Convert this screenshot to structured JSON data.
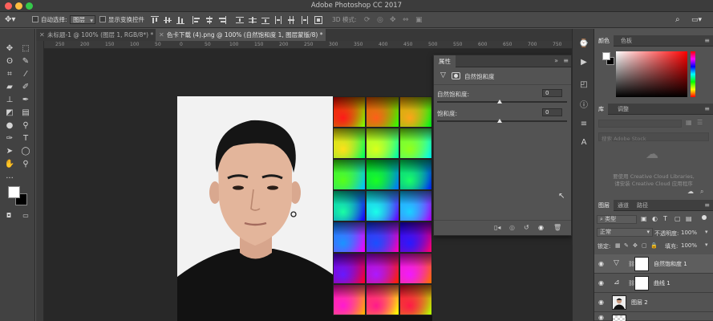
{
  "window": {
    "title": "Adobe Photoshop CC 2017"
  },
  "options_bar": {
    "auto_select_label": "自动选择:",
    "auto_select_value": "图层",
    "show_transform_label": "显示变换控件",
    "mode_3d_label": "3D 模式:"
  },
  "doc_tabs": [
    {
      "label": "未标题-1 @ 100% (图层 1, RGB/8*) *",
      "active": false
    },
    {
      "label": "色卡下载 (4).png @ 100% (自然饱和度 1, 图层蒙版/8) *",
      "active": true
    }
  ],
  "ruler": {
    "ticks": [
      "250",
      "200",
      "150",
      "100",
      "50",
      "0",
      "50",
      "100",
      "150",
      "200",
      "250",
      "300",
      "350",
      "400",
      "450",
      "500",
      "550",
      "600",
      "650",
      "700",
      "750"
    ]
  },
  "properties": {
    "tab": "属性",
    "adjustment_title": "自然饱和度",
    "vibrance_label": "自然饱和度:",
    "vibrance_value": "0",
    "saturation_label": "饱和度:",
    "saturation_value": "0"
  },
  "color_panel": {
    "tabs": [
      "颜色",
      "色板"
    ],
    "hue_color": "#ff0000"
  },
  "library_panel": {
    "tabs": [
      "库",
      "调整"
    ],
    "search_placeholder": "搜索 Adobe Stock",
    "message_line1": "要使用 Creative Cloud Libraries,",
    "message_line2": "请安装 Creative Cloud 应用程序"
  },
  "layers_panel": {
    "tabs": [
      "图层",
      "通道",
      "路径"
    ],
    "filter_kind": "类型",
    "blend_mode": "正常",
    "opacity_label": "不透明度:",
    "opacity_value": "100%",
    "lock_label": "锁定:",
    "fill_label": "填充:",
    "fill_value": "100%",
    "layers": [
      {
        "name": "自然饱和度 1",
        "selected": true
      },
      {
        "name": "曲线 1",
        "selected": false
      },
      {
        "name": "图层 2",
        "selected": false
      }
    ]
  },
  "colors": {
    "foreground": "#ffffff",
    "background": "#000000"
  }
}
